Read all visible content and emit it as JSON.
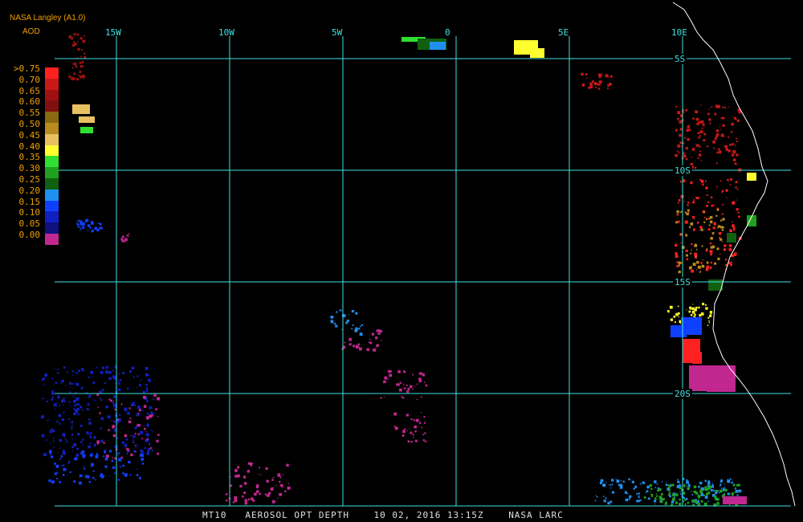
{
  "header": {
    "producer": "NASA Langley (A1.0)",
    "variable": "AOD"
  },
  "footer": {
    "satellite": "MT10",
    "product": "AEROSOL OPT DEPTH",
    "datetime": "10 02, 2016 13:15Z",
    "source": "NASA LARC"
  },
  "longitude_labels": [
    {
      "label": "15W",
      "lon": -15
    },
    {
      "label": "10W",
      "lon": -10
    },
    {
      "label": "5W",
      "lon": -5
    },
    {
      "label": "0",
      "lon": 0
    },
    {
      "label": "5E",
      "lon": 5
    },
    {
      "label": "10E",
      "lon": 10
    }
  ],
  "latitude_labels": [
    {
      "label": "5S",
      "lat": -5
    },
    {
      "label": "10S",
      "lat": -10
    },
    {
      "label": "15S",
      "lat": -15
    },
    {
      "label": "20S",
      "lat": -20
    }
  ],
  "legend": {
    "labels": [
      ">0.75",
      "0.70",
      "0.65",
      "0.60",
      "0.55",
      "0.50",
      "0.45",
      "0.40",
      "0.35",
      "0.30",
      "0.25",
      "0.20",
      "0.15",
      "0.10",
      "0.05",
      "0.00"
    ],
    "colors": [
      "#ff2020",
      "#c81818",
      "#a01010",
      "#801010",
      "#8a6a10",
      "#b88a20",
      "#e8c060",
      "#ffff30",
      "#30e030",
      "#20a020",
      "#106010",
      "#2090f0",
      "#1040ff",
      "#1020c0",
      "#101080",
      "#c02890"
    ]
  },
  "colors": {
    "grid": "#40e0e0",
    "coast": "#ffffff",
    "labels": "#f0a000"
  }
}
